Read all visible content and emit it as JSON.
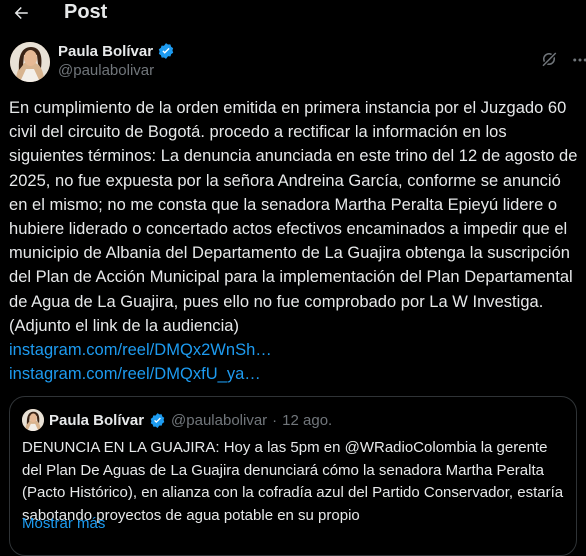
{
  "header": {
    "title": "Post",
    "back_icon": "arrow-left-icon"
  },
  "author": {
    "display_name": "Paula Bolívar",
    "handle": "@paulabolivar",
    "verified": true,
    "verified_color": "#1d9bf0"
  },
  "post": {
    "text": "En cumplimiento de la orden emitida en primera instancia por el Juzgado 60 civil del circuito de Bogotá. procedo a rectificar la información en los siguientes términos: La denuncia anunciada en este trino del 12 de agosto de 2025, no fue expuesta por la señora Andreina García, conforme se anunció en el mismo; no me consta que la senadora Martha Peralta Epieyú lidere o hubiere liderado o concertado actos efectivos encaminados a impedir que el municipio de Albania del Departamento de La Guajira obtenga la suscripción del Plan de Acción Municipal para la implementación del Plan Departamental de Agua de La Guajira, pues ello no fue comprobado por La W Investiga. (Adjunto el link de la audiencia)",
    "links": [
      "instagram.com/reel/DMQx2WnSh…",
      "instagram.com/reel/DMQxfU_ya…"
    ]
  },
  "quote": {
    "display_name": "Paula Bolívar",
    "handle": "@paulabolivar",
    "separator": "·",
    "date": "12 ago.",
    "text": "DENUNCIA EN LA GUAJIRA: Hoy a las 5pm en @WRadioColombia la gerente del Plan De Aguas de La Guajira denunciará cómo la senadora Martha Peralta (Pacto Histórico), en alianza con la cofradía azul del Partido Conservador, estaría sabotando proyectos de agua potable en su propio",
    "show_more": "Mostrar más"
  },
  "icons": [
    "arrow-left-icon",
    "verified-badge-icon",
    "grok-icon",
    "more-icon"
  ],
  "colors": {
    "background": "#000000",
    "text": "#e7e9ea",
    "secondary": "#71767b",
    "link": "#1d9bf0",
    "border": "#2f3336"
  }
}
